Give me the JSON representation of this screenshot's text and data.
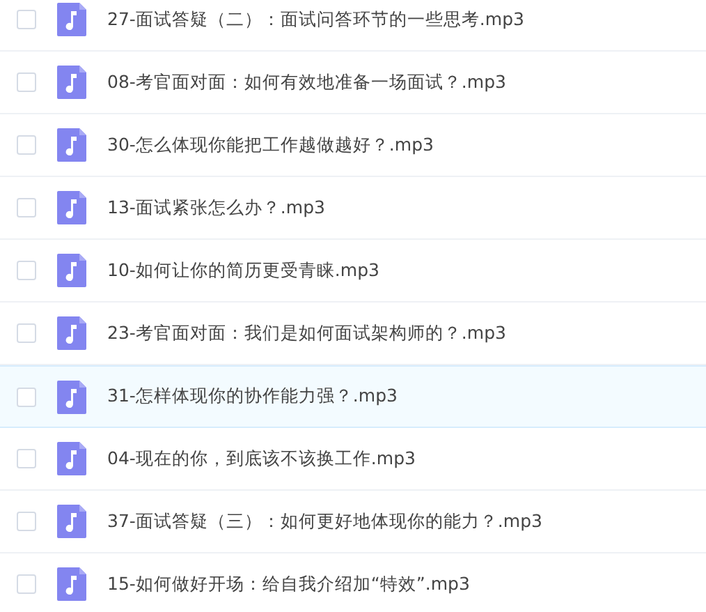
{
  "files": [
    {
      "name": "27-面试答疑（二）：面试问答环节的一些思考.mp3",
      "checked": false,
      "selected": false
    },
    {
      "name": "08-考官面对面：如何有效地准备一场面试？.mp3",
      "checked": false,
      "selected": false
    },
    {
      "name": "30-怎么体现你能把工作越做越好？.mp3",
      "checked": false,
      "selected": false
    },
    {
      "name": "13-面试紧张怎么办？.mp3",
      "checked": false,
      "selected": false
    },
    {
      "name": "10-如何让你的简历更受青睐.mp3",
      "checked": false,
      "selected": false
    },
    {
      "name": "23-考官面对面：我们是如何面试架构师的？.mp3",
      "checked": false,
      "selected": false
    },
    {
      "name": "31-怎样体现你的协作能力强？.mp3",
      "checked": false,
      "selected": true
    },
    {
      "name": "04-现在的你，到底该不该换工作.mp3",
      "checked": false,
      "selected": false
    },
    {
      "name": "37-面试答疑（三）：如何更好地体现你的能力？.mp3",
      "checked": false,
      "selected": false
    },
    {
      "name": "15-如何做好开场：给自我介绍加“特效”.mp3",
      "checked": false,
      "selected": false
    }
  ]
}
